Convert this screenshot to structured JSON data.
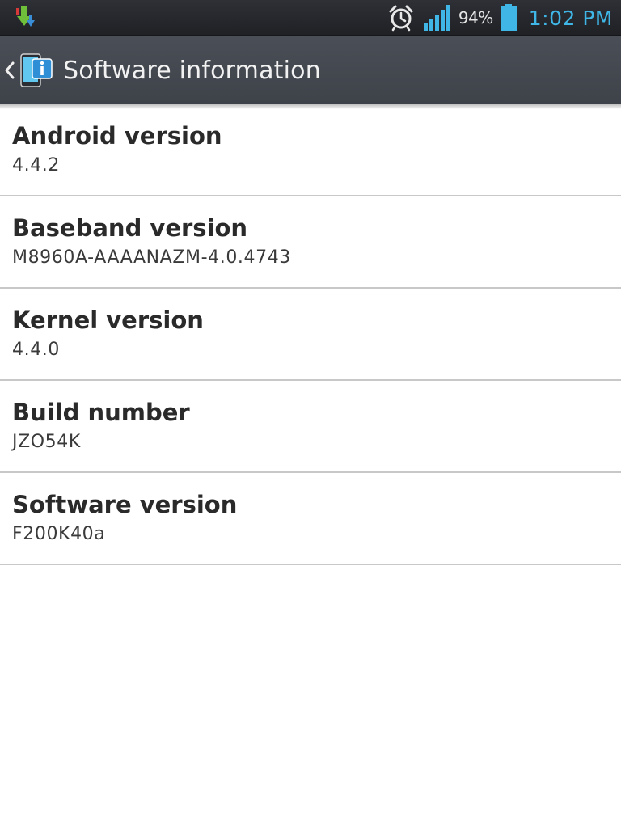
{
  "status_bar": {
    "notification_icon": "download-icon",
    "alarm_icon": "alarm-clock-icon",
    "signal_icon": "signal-strength-icon",
    "battery_percent": "94%",
    "battery_level": 0.94,
    "battery_icon": "battery-icon",
    "time": "1:02 PM",
    "accent_color": "#3fb6e6"
  },
  "action_bar": {
    "back_icon": "chevron-left-icon",
    "app_icon": "software-info-icon",
    "title": "Software information"
  },
  "info_items": [
    {
      "title": "Android version",
      "value": "4.4.2"
    },
    {
      "title": "Baseband version",
      "value": "M8960A-AAAANAZM-4.0.4743"
    },
    {
      "title": "Kernel version",
      "value": "4.4.0"
    },
    {
      "title": "Build number",
      "value": "JZO54K"
    },
    {
      "title": "Software version",
      "value": "F200K40a"
    }
  ]
}
